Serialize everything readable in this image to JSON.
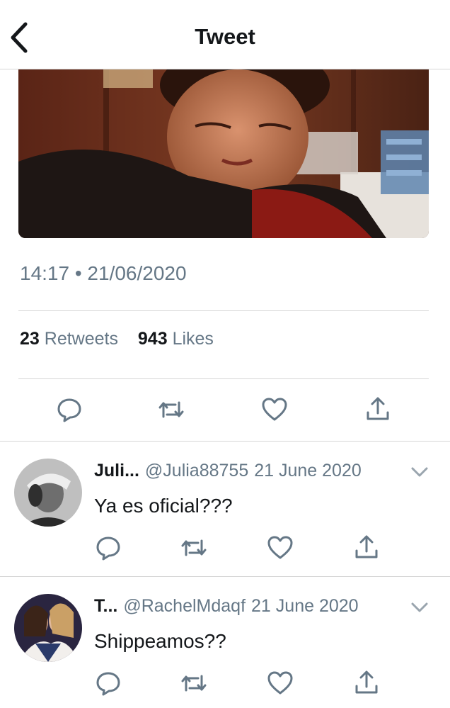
{
  "header": {
    "title": "Tweet",
    "back_icon": "chevron-left-icon"
  },
  "tweet": {
    "image_alt": "photo",
    "timestamp": "14:17 • 21/06/2020",
    "retweets_count": "23",
    "retweets_label": "Retweets",
    "likes_count": "943",
    "likes_label": "Likes",
    "actions": [
      "reply-icon",
      "retweet-icon",
      "like-icon",
      "share-icon"
    ]
  },
  "replies": [
    {
      "name": "Juli...",
      "handle": "@Julia88755",
      "date": "21 June 2020",
      "text": "Ya es oficial???"
    },
    {
      "name": "T...",
      "handle": "@RachelMdaqf",
      "date": "21 June 2020",
      "text": "Shippeamos??"
    }
  ],
  "colors": {
    "text": "#14171a",
    "secondary": "#657786",
    "divider": "#d6d6d6"
  }
}
